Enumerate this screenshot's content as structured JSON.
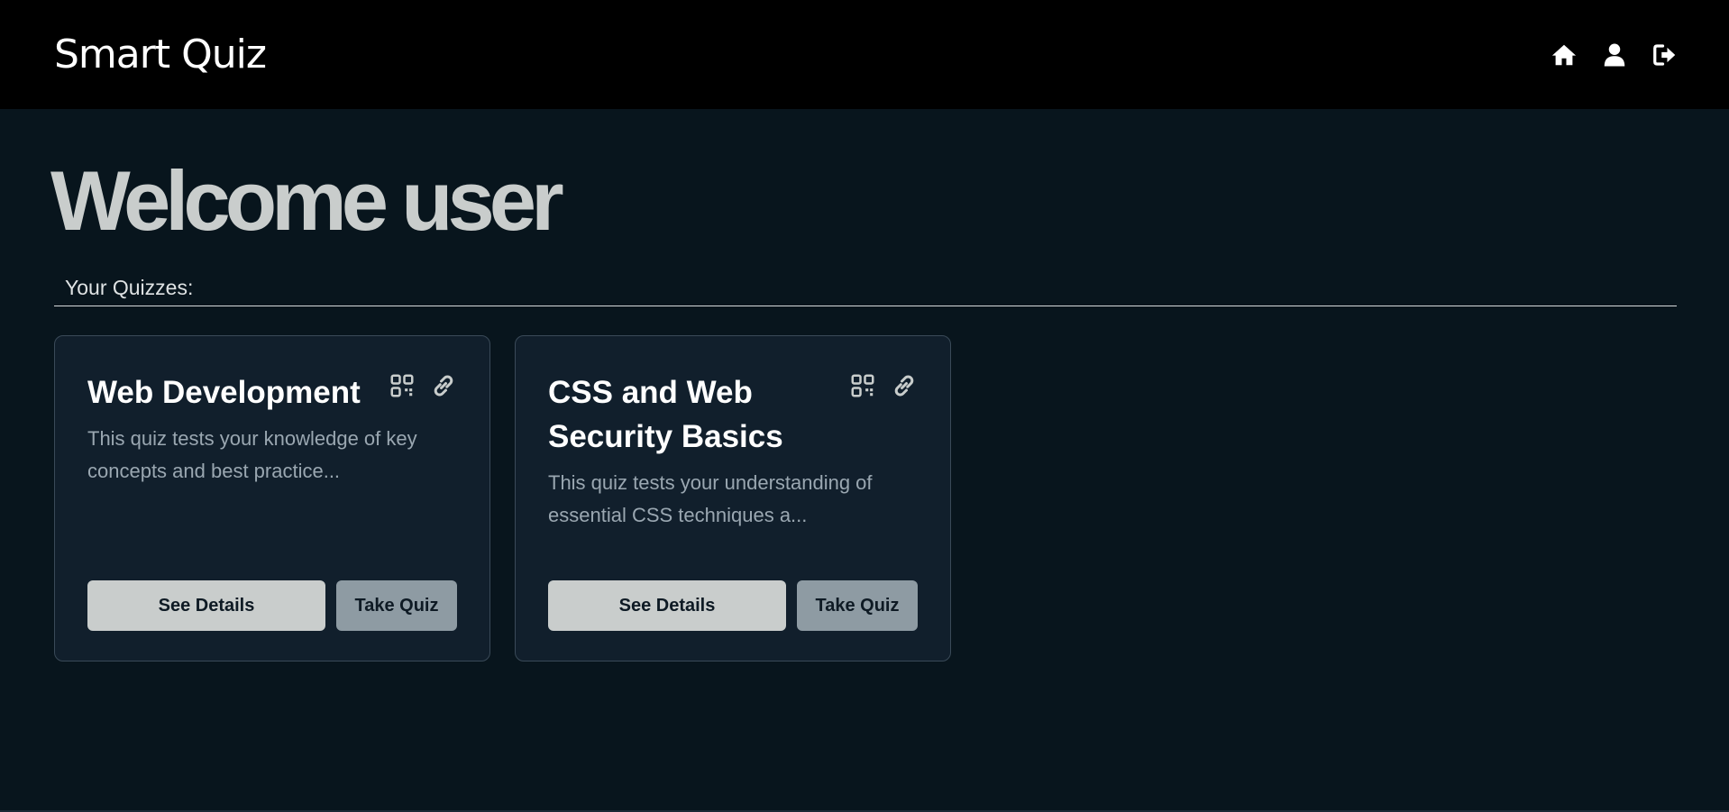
{
  "navbar": {
    "brand": "Smart Quiz",
    "icons": [
      "home-icon",
      "user-icon",
      "logout-icon"
    ]
  },
  "welcome": "Welcome user",
  "section_label": "Your Quizzes:",
  "quizzes": [
    {
      "title": "Web Development",
      "description": "This quiz tests your knowledge of key concepts and best practice...",
      "details_label": "See Details",
      "take_label": "Take Quiz",
      "icons": [
        "qr-code-icon",
        "link-icon"
      ]
    },
    {
      "title": "CSS and Web Security Basics",
      "description": "This quiz tests your understanding of essential CSS techniques a...",
      "details_label": "See Details",
      "take_label": "Take Quiz",
      "icons": [
        "qr-code-icon",
        "link-icon"
      ]
    }
  ],
  "colors": {
    "page_background": "#08151d",
    "navbar_background": "#000000",
    "card_background": "#111f2c",
    "details_button": "#c9cdcc",
    "take_button": "#8e9ba3"
  }
}
